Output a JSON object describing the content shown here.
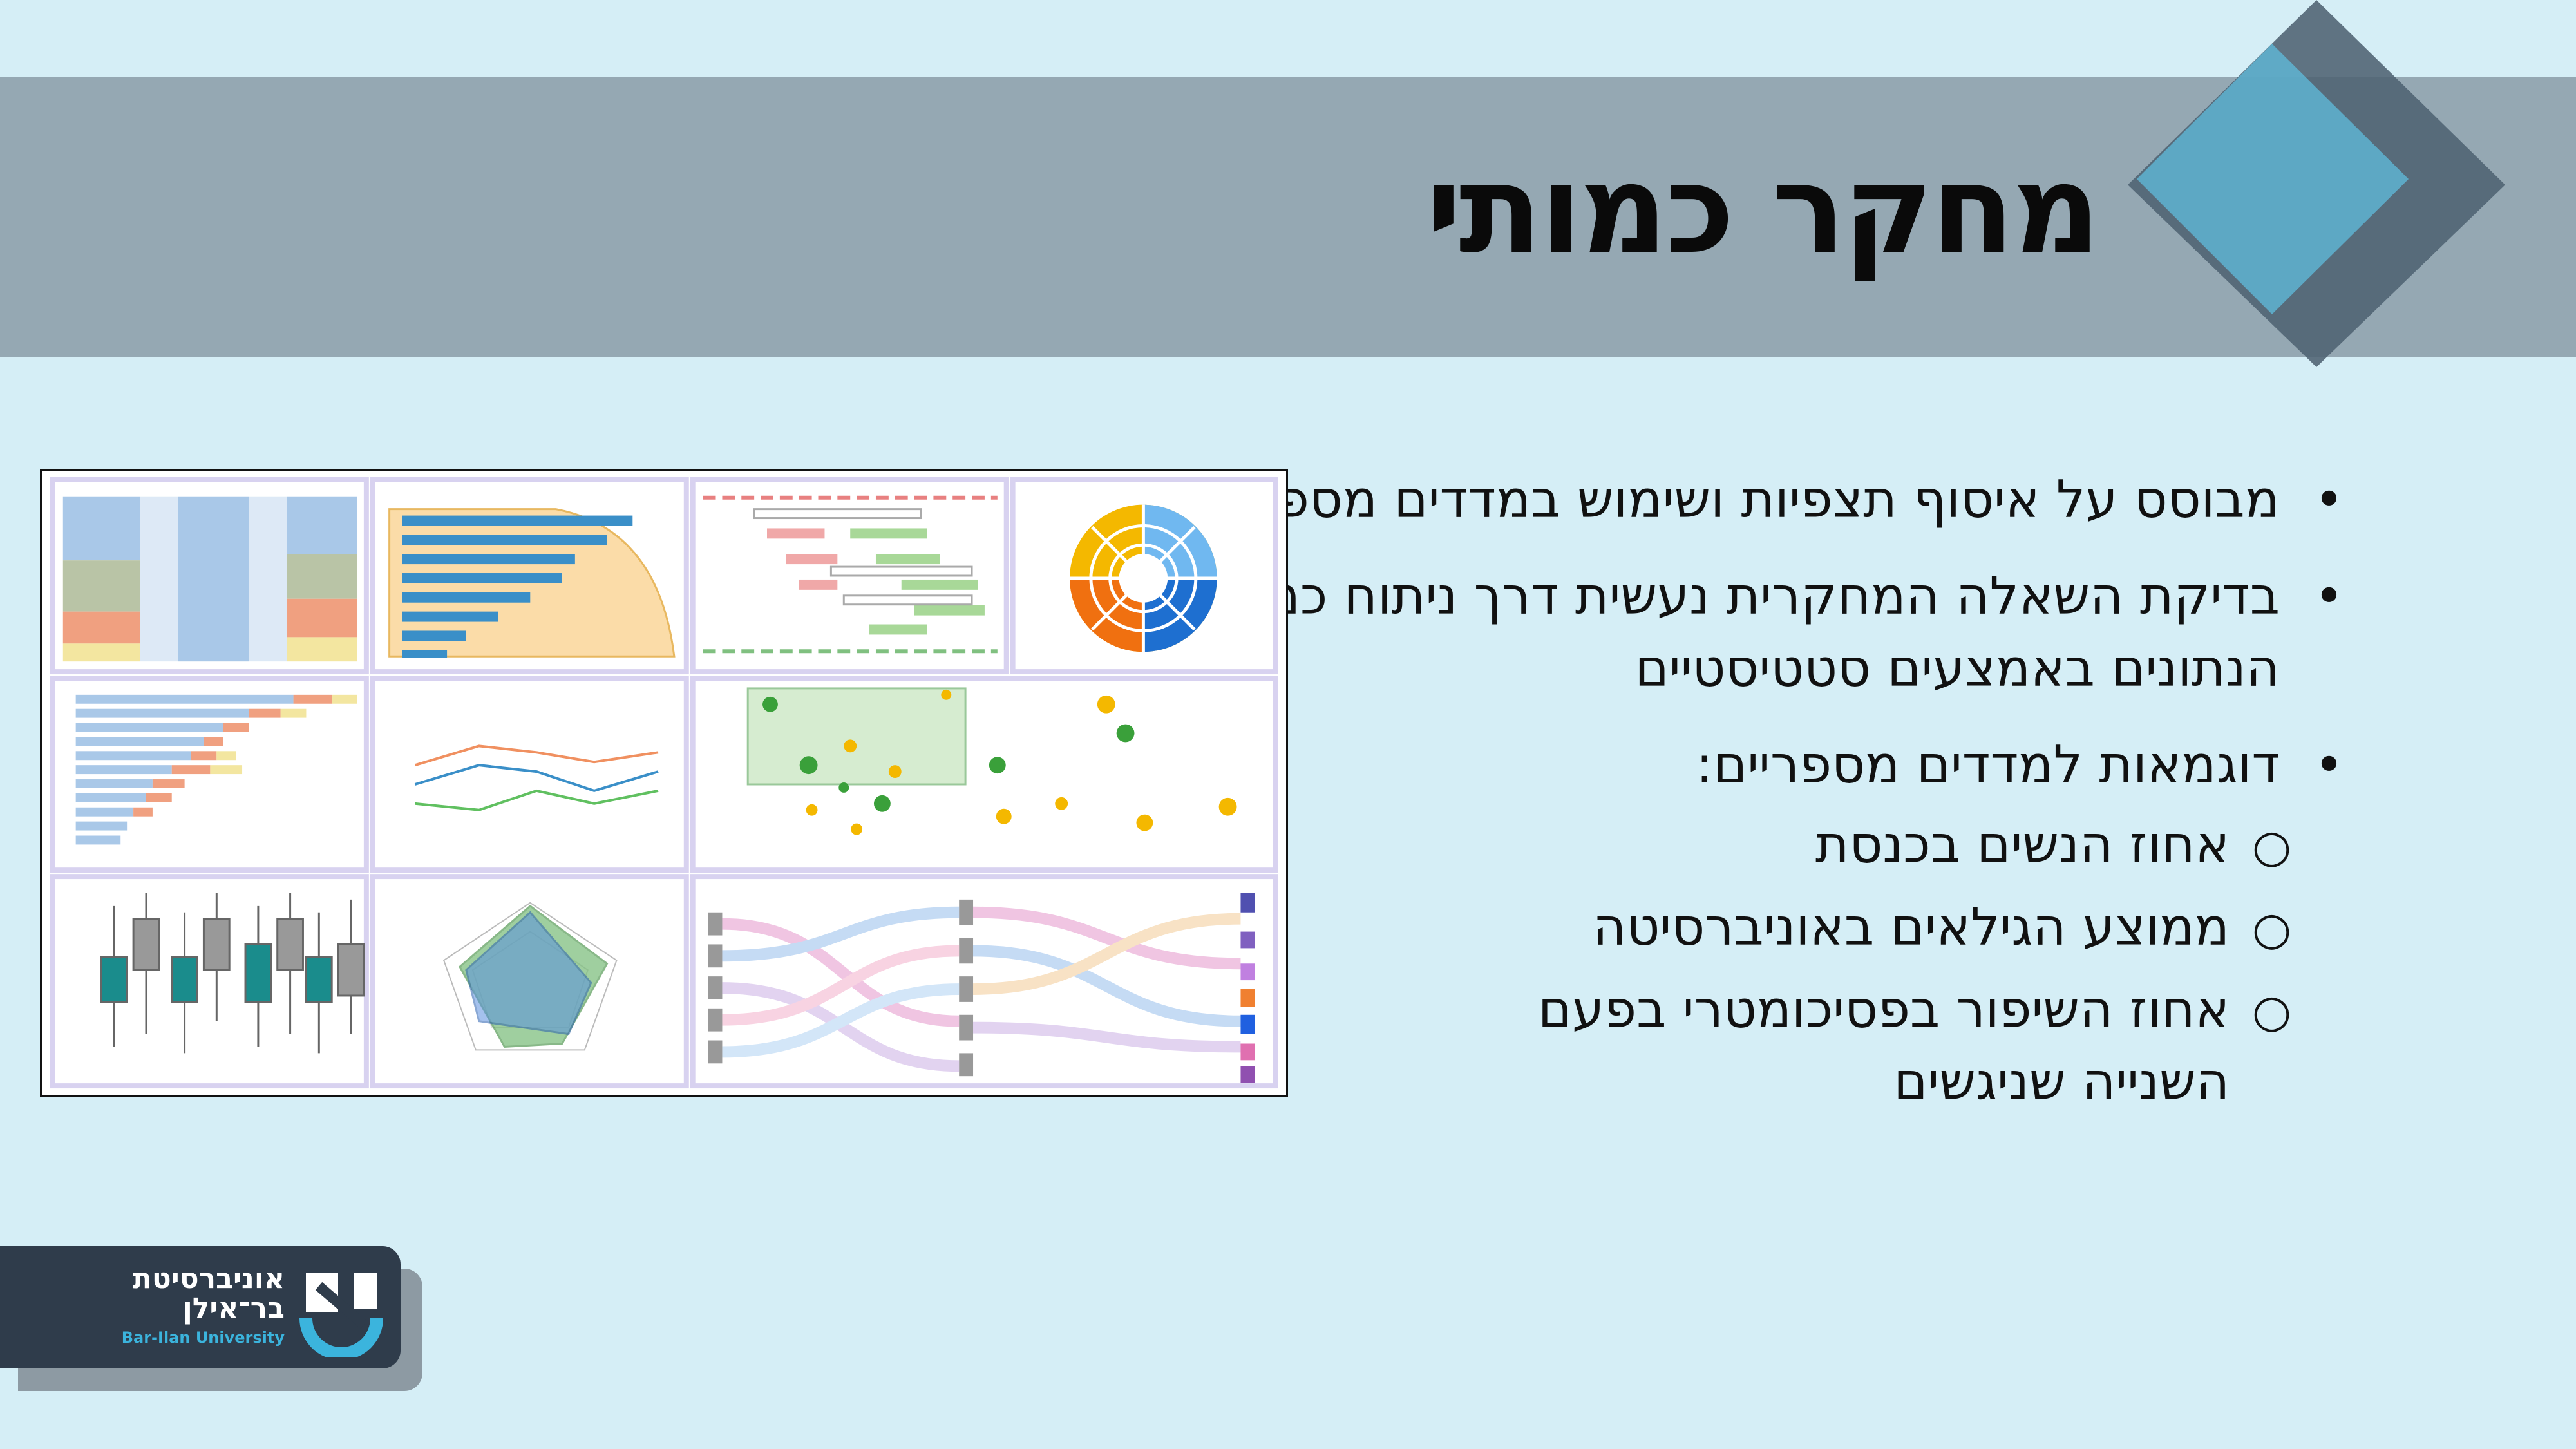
{
  "slide": {
    "title": "מחקר כמותי",
    "bullets": [
      {
        "text": "מבוסס על איסוף תצפיות ושימוש במדדים מספריים"
      },
      {
        "text": "בדיקת השאלה המחקרית נעשית דרך ניתוח כמותי של הנתונים באמצעים סטטיסטיים"
      },
      {
        "text": "דוגמאות למדדים מספריים:"
      }
    ],
    "sub_bullets": [
      {
        "text": "אחוז הנשים בכנסת"
      },
      {
        "text": "ממוצע הגילאים באוניברסיטה"
      },
      {
        "text": "אחוז השיפור בפסיכומטרי בפעם השנייה שניגשים"
      }
    ],
    "bullet_symbol": "•",
    "sub_bullet_symbol": "○"
  },
  "collage": {
    "description_icon": "dashboard-charts-image",
    "panel_types": [
      "alluvial",
      "horizontal-bar",
      "gantt",
      "sunburst",
      "stacked-bar",
      "line",
      "bubble-scatter",
      "box-plot",
      "radar",
      "sankey"
    ]
  },
  "logo": {
    "hebrew_line1": "אוניברסיטת",
    "hebrew_line2": "בר־אילן",
    "english": "Bar-Ilan University"
  },
  "colors": {
    "background": "#d5eef6",
    "title_band": "#95a8b3",
    "diamond_dark": "#4f6272",
    "diamond_light": "#5fb8d8",
    "logo_bg": "#2f3c4b",
    "logo_accent": "#3bb4dd"
  }
}
